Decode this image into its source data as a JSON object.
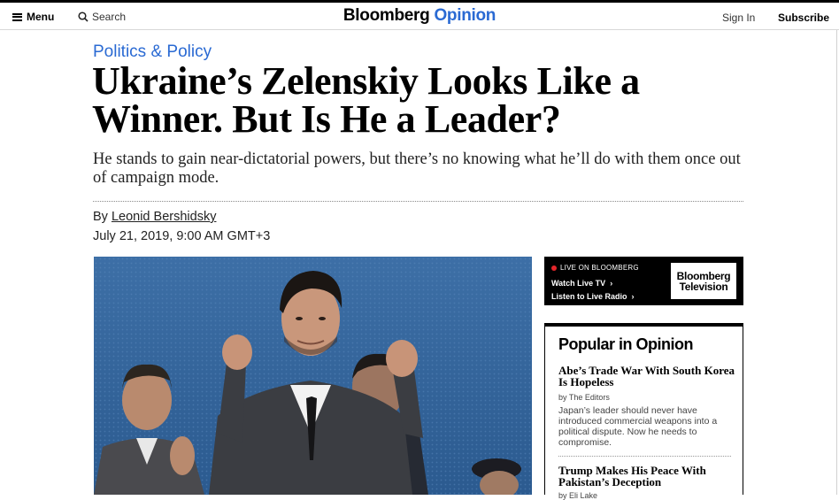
{
  "header": {
    "menu_label": "Menu",
    "search_label": "Search",
    "logo_main": "Bloomberg",
    "logo_sub": "Opinion",
    "signin_label": "Sign In",
    "subscribe_label": "Subscribe"
  },
  "article": {
    "category": "Politics & Policy",
    "headline_line1": "Ukraine’s Zelenskiy Looks Like a",
    "headline_line2": "Winner. But Is He a Leader?",
    "dek": "He stands to gain near-dictatorial powers, but there’s no knowing what he’ll do with them once out of campaign mode.",
    "byline_prefix": "By",
    "author": "Leonid Bershidsky",
    "date": "July 21, 2019, 9:00 AM GMT+3"
  },
  "live": {
    "label": "LIVE ON BLOOMBERG",
    "watch": "Watch Live TV",
    "listen": "Listen to Live Radio",
    "tv_logo_line1": "Bloomberg",
    "tv_logo_line2": "Television"
  },
  "popular": {
    "heading": "Popular in Opinion",
    "items": [
      {
        "title": "Abe’s Trade War With South Korea Is Hopeless",
        "byline": "by The Editors",
        "summary": "Japan’s leader should never have introduced commercial weapons into a political dispute. Now he needs to compromise."
      },
      {
        "title": "Trump Makes His Peace With Pakistan’s Deception",
        "byline": "by Eli Lake"
      }
    ]
  },
  "colors": {
    "accent": "#2a6ad3",
    "live_dot": "#e4262b"
  },
  "icons": [
    "hamburger-icon",
    "search-icon",
    "chevron-right-icon",
    "live-dot-icon"
  ]
}
